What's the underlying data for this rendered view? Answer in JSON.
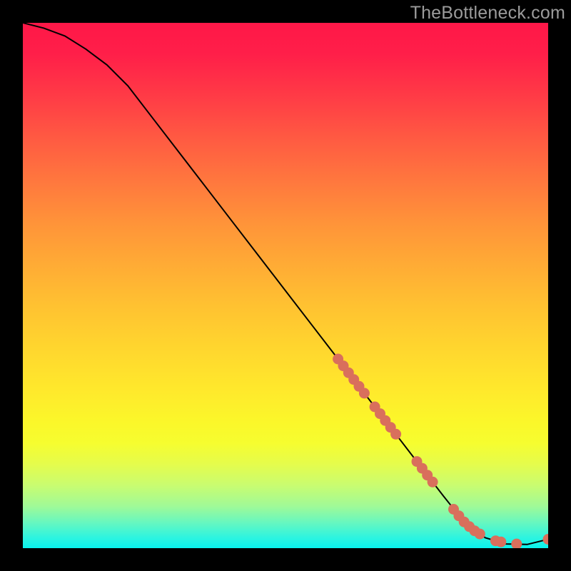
{
  "watermark": "TheBottleneck.com",
  "chart_data": {
    "type": "line",
    "title": "",
    "xlabel": "",
    "ylabel": "",
    "xlim": [
      0,
      100
    ],
    "ylim": [
      0,
      100
    ],
    "curve": {
      "x": [
        0,
        4,
        8,
        12,
        16,
        20,
        25,
        30,
        35,
        40,
        45,
        50,
        55,
        60,
        65,
        70,
        75,
        80,
        84,
        88,
        92,
        96,
        100
      ],
      "y": [
        100,
        99,
        97.5,
        95,
        92,
        88,
        81.5,
        75,
        68.5,
        62,
        55.5,
        49,
        42.5,
        36,
        29.5,
        23,
        16.5,
        10,
        5,
        2,
        0.8,
        0.7,
        1.7
      ]
    },
    "scatter": {
      "x": [
        60,
        61,
        62,
        63,
        64,
        65,
        67,
        68,
        69,
        70,
        71,
        75,
        76,
        77,
        78,
        82,
        83,
        84,
        85,
        86,
        87,
        90,
        91,
        94,
        100
      ],
      "y": [
        36,
        34.7,
        33.4,
        32.1,
        30.8,
        29.5,
        26.9,
        25.6,
        24.3,
        23,
        21.7,
        16.5,
        15.2,
        13.9,
        12.6,
        7.4,
        6.15,
        5,
        4.1,
        3.3,
        2.7,
        1.4,
        1.2,
        0.8,
        1.7
      ]
    },
    "colors": {
      "curve": "#000000",
      "dots": "#d96f5c"
    }
  }
}
